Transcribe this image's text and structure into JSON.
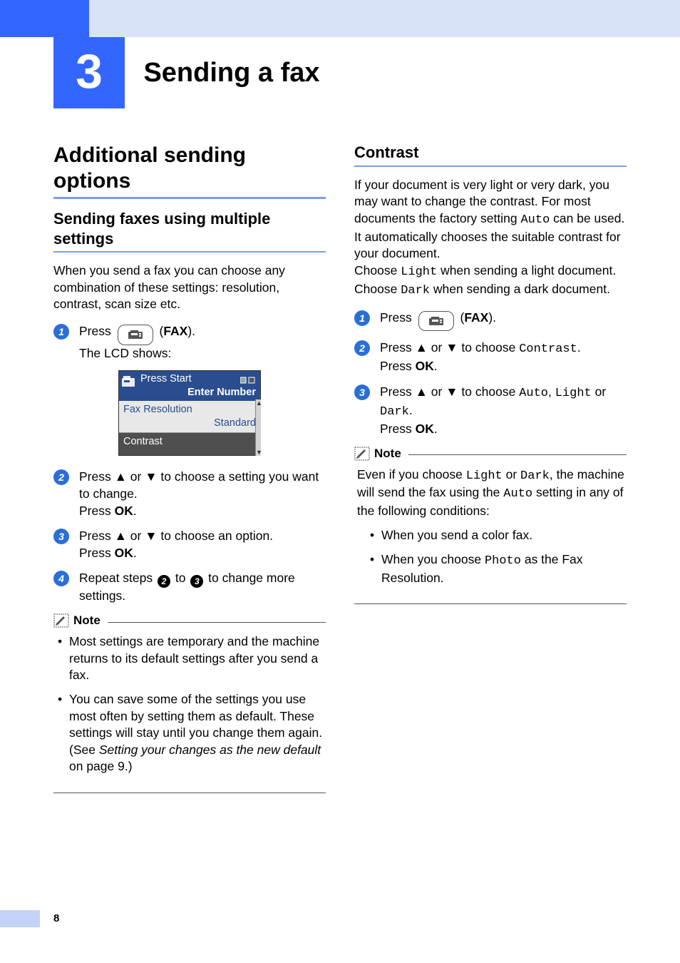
{
  "chapter": {
    "number": "3",
    "title": "Sending a fax"
  },
  "page_number": "8",
  "left": {
    "h2": "Additional sending options",
    "h3": "Sending faxes using multiple settings",
    "intro": "When you send a fax you can choose any combination of these settings: resolution, contrast, scan size etc.",
    "step1_a": "Press ",
    "step1_b": " (",
    "step1_fax": "FAX",
    "step1_c": ").",
    "step1_line2": "The LCD shows:",
    "lcd": {
      "line1": "Press Start",
      "line2": "Enter Number",
      "item1_label": "Fax Resolution",
      "item1_value": "Standard",
      "item2_label": "Contrast"
    },
    "step2_a": "Press ",
    "step2_b": " or ",
    "step2_c": " to choose a setting you want to change.",
    "step2_d": "Press ",
    "step2_ok": "OK",
    "step2_e": ".",
    "step3_a": "Press ",
    "step3_b": " or ",
    "step3_c": " to choose an option.",
    "step3_d": "Press ",
    "step3_ok": "OK",
    "step3_e": ".",
    "step4_a": "Repeat steps ",
    "step4_b": " to ",
    "step4_c": " to change more settings.",
    "note_title": "Note",
    "note_items": [
      "Most settings are temporary and the machine returns to its default settings after you send a fax."
    ],
    "note_item2_a": "You can save some of the settings you use most often by setting them as default. These settings will stay until you change them again. (See ",
    "note_item2_italic": "Setting your changes as the new default",
    "note_item2_b": " on page 9.)"
  },
  "right": {
    "h3": "Contrast",
    "p1_a": "If your document is very light or very dark, you may want to change the contrast. For most documents the factory setting ",
    "p1_auto": "Auto",
    "p1_b": " can be used. It automatically chooses the suitable contrast for your document.",
    "p2_a": "Choose ",
    "p2_light": "Light",
    "p2_b": " when sending a light document.",
    "p3_a": "Choose ",
    "p3_dark": "Dark",
    "p3_b": " when sending a dark document.",
    "step1_a": "Press ",
    "step1_b": " (",
    "step1_fax": "FAX",
    "step1_c": ").",
    "step2_a": "Press ",
    "step2_b": " or ",
    "step2_c": " to choose ",
    "step2_contrast": "Contrast",
    "step2_d": ".",
    "step2_e": "Press ",
    "step2_ok": "OK",
    "step2_f": ".",
    "step3_a": "Press ",
    "step3_b": " or ",
    "step3_c": " to choose ",
    "step3_auto": "Auto",
    "step3_d": ", ",
    "step3_light": "Light",
    "step3_e": " or ",
    "step3_dark": "Dark",
    "step3_f": ".",
    "step3_g": "Press ",
    "step3_ok": "OK",
    "step3_h": ".",
    "note_title": "Note",
    "note_p_a": "Even if you choose ",
    "note_p_light": "Light",
    "note_p_b": " or ",
    "note_p_dark": "Dark",
    "note_p_c": ", the machine will send the fax using the ",
    "note_p_auto": "Auto",
    "note_p_d": " setting in any of the following conditions:",
    "note_li1": "When you send a color fax.",
    "note_li2_a": "When you choose ",
    "note_li2_photo": "Photo",
    "note_li2_b": " as the Fax Resolution."
  },
  "glyphs": {
    "up": "▲",
    "down": "▼"
  }
}
